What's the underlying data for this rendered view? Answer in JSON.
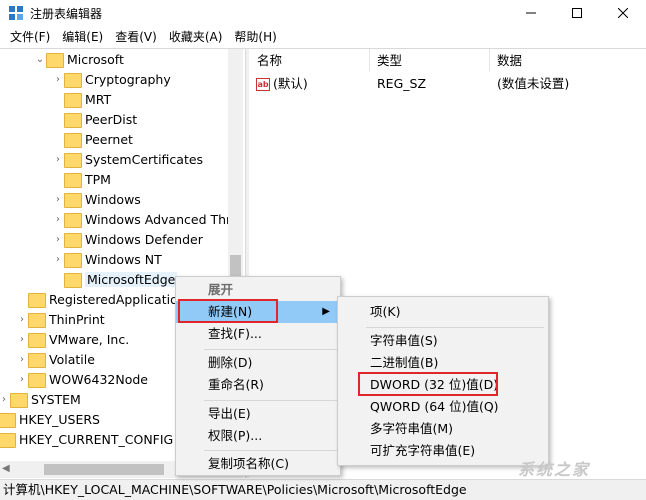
{
  "window": {
    "title": "注册表编辑器",
    "minimize_icon": "minimize-icon",
    "maximize_icon": "maximize-icon",
    "close_icon": "close-icon"
  },
  "menubar": [
    "文件(F)",
    "编辑(E)",
    "查看(V)",
    "收藏夹(A)",
    "帮助(H)"
  ],
  "tree": {
    "nodes": [
      {
        "label": "Microsoft",
        "expanded": true
      },
      {
        "label": "Cryptography",
        "has_children": true
      },
      {
        "label": "MRT"
      },
      {
        "label": "PeerDist"
      },
      {
        "label": "Peernet"
      },
      {
        "label": "SystemCertificates",
        "has_children": true
      },
      {
        "label": "TPM"
      },
      {
        "label": "Windows",
        "has_children": true
      },
      {
        "label": "Windows Advanced Thr",
        "has_children": true
      },
      {
        "label": "Windows Defender",
        "has_children": true
      },
      {
        "label": "Windows NT",
        "has_children": true
      },
      {
        "label": "MicrosoftEdge",
        "selected": true
      },
      {
        "label": "RegisteredApplicatio"
      },
      {
        "label": "ThinPrint",
        "has_children": true
      },
      {
        "label": "VMware, Inc.",
        "has_children": true
      },
      {
        "label": "Volatile",
        "has_children": true
      },
      {
        "label": "WOW6432Node",
        "has_children": true
      },
      {
        "label": "SYSTEM",
        "has_children": true
      },
      {
        "label": "HKEY_USERS",
        "has_children": true
      },
      {
        "label": "HKEY_CURRENT_CONFIG",
        "has_children": true
      }
    ]
  },
  "values_pane": {
    "columns": [
      "名称",
      "类型",
      "数据"
    ],
    "rows": [
      {
        "icon": "ab",
        "name": "(默认)",
        "type": "REG_SZ",
        "data": "(数值未设置)"
      }
    ]
  },
  "context_menu": {
    "items": [
      "展开",
      "新建(N)",
      "查找(F)...",
      "删除(D)",
      "重命名(R)",
      "导出(E)",
      "权限(P)...",
      "复制项名称(C)"
    ],
    "highlighted": "新建(N)"
  },
  "submenu": {
    "items": [
      "项(K)",
      "字符串值(S)",
      "二进制值(B)",
      "DWORD (32 位)值(D)",
      "QWORD (64 位)值(Q)",
      "多字符串值(M)",
      "可扩充字符串值(E)"
    ],
    "boxed": "DWORD (32 位)值(D)"
  },
  "statusbar": {
    "path": "计算机\\HKEY_LOCAL_MACHINE\\SOFTWARE\\Policies\\Microsoft\\MicrosoftEdge"
  },
  "watermark": "系统之家",
  "colors": {
    "highlight": "#91c9f7",
    "red_box": "#e0262a",
    "folder": "#ffd86b"
  }
}
